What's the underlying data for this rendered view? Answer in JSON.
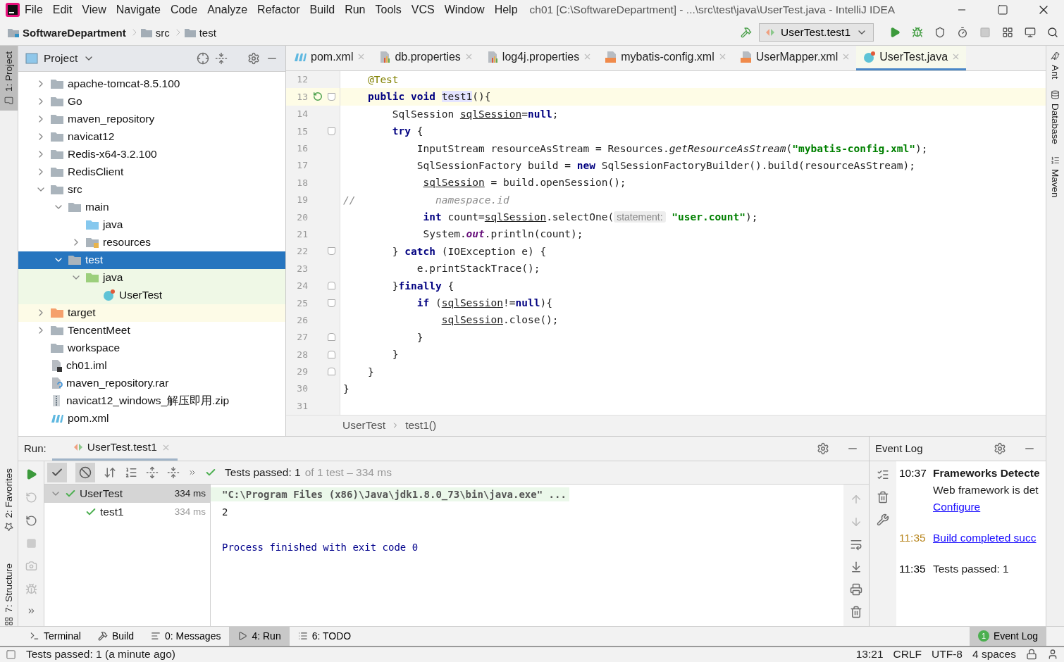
{
  "window": {
    "title": "ch01 [C:\\SoftwareDepartment] - ...\\src\\test\\java\\UserTest.java - IntelliJ IDEA"
  },
  "menu": [
    "File",
    "Edit",
    "View",
    "Navigate",
    "Code",
    "Analyze",
    "Refactor",
    "Build",
    "Run",
    "Tools",
    "VCS",
    "Window",
    "Help"
  ],
  "breadcrumbs": [
    {
      "label": "SoftwareDepartment",
      "kind": "project"
    },
    {
      "label": "src",
      "kind": "folder"
    },
    {
      "label": "test",
      "kind": "folder"
    }
  ],
  "run_config": {
    "label": "UserTest.test1"
  },
  "side_stripes": {
    "left": [
      {
        "label": "1: Project",
        "selected": true,
        "kind": "project"
      },
      {
        "label": "2: Favorites",
        "selected": false,
        "kind": "favorites"
      },
      {
        "label": "7: Structure",
        "selected": false,
        "kind": "structure"
      }
    ],
    "right": [
      {
        "label": "Ant",
        "kind": "ant"
      },
      {
        "label": "Database",
        "kind": "database"
      },
      {
        "label": "Maven",
        "kind": "maven"
      }
    ]
  },
  "project_panel": {
    "title": "Project",
    "tree": [
      {
        "label": "apache-tomcat-8.5.100",
        "kind": "folder",
        "expanded": false,
        "selected": false
      },
      {
        "label": "Go",
        "kind": "folder",
        "expanded": false,
        "selected": false
      },
      {
        "label": "maven_repository",
        "kind": "folder",
        "expanded": false,
        "selected": false
      },
      {
        "label": "navicat12",
        "kind": "folder",
        "expanded": false,
        "selected": false
      },
      {
        "label": "Redis-x64-3.2.100",
        "kind": "folder",
        "expanded": false,
        "selected": false
      },
      {
        "label": "RedisClient",
        "kind": "folder",
        "expanded": false,
        "selected": false
      },
      {
        "label": "src",
        "kind": "folder",
        "expanded": true,
        "selected": false,
        "children": [
          {
            "label": "main",
            "kind": "folder",
            "expanded": true,
            "selected": false,
            "children": [
              {
                "label": "java",
                "kind": "source",
                "selected": false
              },
              {
                "label": "resources",
                "kind": "resources",
                "expanded": false,
                "selected": false
              }
            ]
          },
          {
            "label": "test",
            "kind": "folder",
            "expanded": true,
            "selected": true,
            "children": [
              {
                "label": "java",
                "kind": "test",
                "expanded": true,
                "selected": false,
                "children": [
                  {
                    "label": "UserTest",
                    "kind": "class",
                    "selected": false
                  }
                ]
              }
            ]
          }
        ]
      },
      {
        "label": "target",
        "kind": "excluded",
        "expanded": false,
        "selected": false
      },
      {
        "label": "TencentMeet",
        "kind": "folder",
        "expanded": false,
        "selected": false
      },
      {
        "label": "workspace",
        "kind": "folder",
        "selected": false
      },
      {
        "label": "ch01.iml",
        "kind": "iml",
        "selected": false
      },
      {
        "label": "maven_repository.rar",
        "kind": "unknown",
        "selected": false
      },
      {
        "label": "navicat12_windows_解压即用.zip",
        "kind": "zip",
        "selected": false
      },
      {
        "label": "pom.xml",
        "kind": "maven",
        "selected": false
      }
    ]
  },
  "editor": {
    "tabs": [
      {
        "label": "pom.xml",
        "kind": "maven",
        "selected": false
      },
      {
        "label": "db.properties",
        "kind": "properties",
        "selected": false
      },
      {
        "label": "log4j.properties",
        "kind": "properties",
        "selected": false
      },
      {
        "label": "mybatis-config.xml",
        "kind": "xml",
        "selected": false
      },
      {
        "label": "UserMapper.xml",
        "kind": "xml",
        "selected": false
      },
      {
        "label": "UserTest.java",
        "kind": "class",
        "selected": true
      }
    ],
    "lines": [
      {
        "number": "12",
        "current": false,
        "runnable": false,
        "fold_start": false,
        "fold_end": false,
        "tokens": [
          {
            "kind": "ann",
            "text": "    @Test"
          }
        ]
      },
      {
        "number": "13",
        "current": true,
        "runnable": true,
        "fold_start": true,
        "fold_end": false,
        "tokens": [
          {
            "kind": "kw",
            "text": "    public void "
          },
          {
            "kind": "match",
            "text": "test1"
          },
          {
            "kind": "plain",
            "text": "(){"
          }
        ]
      },
      {
        "number": "14",
        "current": false,
        "runnable": false,
        "fold_start": false,
        "fold_end": false,
        "tokens": [
          {
            "kind": "plain",
            "text": "        SqlSession "
          },
          {
            "kind": "var",
            "text": "sqlSession"
          },
          {
            "kind": "plain",
            "text": "="
          },
          {
            "kind": "kw",
            "text": "null"
          },
          {
            "kind": "plain",
            "text": ";"
          }
        ]
      },
      {
        "number": "15",
        "current": false,
        "runnable": false,
        "fold_start": true,
        "fold_end": false,
        "tokens": [
          {
            "kind": "kw",
            "text": "        try"
          },
          {
            "kind": "plain",
            "text": " {"
          }
        ]
      },
      {
        "number": "16",
        "current": false,
        "runnable": false,
        "fold_start": false,
        "fold_end": false,
        "tokens": [
          {
            "kind": "plain",
            "text": "            InputStream resourceAsStream = Resources."
          },
          {
            "kind": "italic",
            "text": "getResourceAsStream"
          },
          {
            "kind": "plain",
            "text": "("
          },
          {
            "kind": "str",
            "text": "\"mybatis-config.xml\""
          },
          {
            "kind": "plain",
            "text": ");"
          }
        ]
      },
      {
        "number": "17",
        "current": false,
        "runnable": false,
        "fold_start": false,
        "fold_end": false,
        "tokens": [
          {
            "kind": "plain",
            "text": "            SqlSessionFactory build = "
          },
          {
            "kind": "kw",
            "text": "new"
          },
          {
            "kind": "plain",
            "text": " SqlSessionFactoryBuilder().build(resourceAsStream);"
          }
        ]
      },
      {
        "number": "18",
        "current": false,
        "runnable": false,
        "fold_start": false,
        "fold_end": false,
        "tokens": [
          {
            "kind": "var",
            "text": "             sqlSession"
          },
          {
            "kind": "plain",
            "text": " = build.openSession();"
          }
        ]
      },
      {
        "number": "19",
        "current": false,
        "runnable": false,
        "fold_start": false,
        "fold_end": false,
        "tokens": [
          {
            "kind": "comment",
            "text": "//             namespace.id"
          }
        ]
      },
      {
        "number": "20",
        "current": false,
        "runnable": false,
        "fold_start": false,
        "fold_end": false,
        "tokens": [
          {
            "kind": "kw",
            "text": "             int"
          },
          {
            "kind": "plain",
            "text": " count="
          },
          {
            "kind": "var",
            "text": "sqlSession"
          },
          {
            "kind": "plain",
            "text": ".selectOne("
          },
          {
            "kind": "hint",
            "text": "statement:"
          },
          {
            "kind": "str",
            "text": " \"user.count\""
          },
          {
            "kind": "plain",
            "text": ");"
          }
        ]
      },
      {
        "number": "21",
        "current": false,
        "runnable": false,
        "fold_start": false,
        "fold_end": false,
        "tokens": [
          {
            "kind": "plain",
            "text": "             System."
          },
          {
            "kind": "field",
            "text": "out"
          },
          {
            "kind": "plain",
            "text": ".println(count);"
          }
        ]
      },
      {
        "number": "22",
        "current": false,
        "runnable": false,
        "fold_start": true,
        "fold_end": false,
        "tokens": [
          {
            "kind": "plain",
            "text": "        } "
          },
          {
            "kind": "kw",
            "text": "catch"
          },
          {
            "kind": "plain",
            "text": " (IOException e) {"
          }
        ]
      },
      {
        "number": "23",
        "current": false,
        "runnable": false,
        "fold_start": false,
        "fold_end": false,
        "tokens": [
          {
            "kind": "plain",
            "text": "            e.printStackTrace();"
          }
        ]
      },
      {
        "number": "24",
        "current": false,
        "runnable": false,
        "fold_start": false,
        "fold_end": true,
        "tokens": [
          {
            "kind": "plain",
            "text": "        }"
          },
          {
            "kind": "kw",
            "text": "finally"
          },
          {
            "kind": "plain",
            "text": " {"
          }
        ]
      },
      {
        "number": "25",
        "current": false,
        "runnable": false,
        "fold_start": true,
        "fold_end": false,
        "tokens": [
          {
            "kind": "kw",
            "text": "            if"
          },
          {
            "kind": "plain",
            "text": " ("
          },
          {
            "kind": "var",
            "text": "sqlSession"
          },
          {
            "kind": "plain",
            "text": "!="
          },
          {
            "kind": "kw",
            "text": "null"
          },
          {
            "kind": "plain",
            "text": "){"
          }
        ]
      },
      {
        "number": "26",
        "current": false,
        "runnable": false,
        "fold_start": false,
        "fold_end": false,
        "tokens": [
          {
            "kind": "var",
            "text": "                sqlSession"
          },
          {
            "kind": "plain",
            "text": ".close();"
          }
        ]
      },
      {
        "number": "27",
        "current": false,
        "runnable": false,
        "fold_start": false,
        "fold_end": true,
        "tokens": [
          {
            "kind": "plain",
            "text": "            }"
          }
        ]
      },
      {
        "number": "28",
        "current": false,
        "runnable": false,
        "fold_start": false,
        "fold_end": true,
        "tokens": [
          {
            "kind": "plain",
            "text": "        }"
          }
        ]
      },
      {
        "number": "29",
        "current": false,
        "runnable": false,
        "fold_start": false,
        "fold_end": true,
        "tokens": [
          {
            "kind": "plain",
            "text": "    }"
          }
        ]
      },
      {
        "number": "30",
        "current": false,
        "runnable": false,
        "fold_start": false,
        "fold_end": false,
        "tokens": [
          {
            "kind": "plain",
            "text": "}"
          }
        ]
      },
      {
        "number": "31",
        "current": false,
        "runnable": false,
        "fold_start": false,
        "fold_end": false
      }
    ],
    "breadcrumb": [
      "UserTest",
      "test1()"
    ]
  },
  "run_panel": {
    "label": "Run:",
    "tab": {
      "label": "UserTest.test1"
    },
    "filters": [
      {
        "kind": "passed",
        "on": true
      },
      {
        "kind": "ignored",
        "on": true
      }
    ],
    "summary": "Tests passed: 1",
    "summary_detail": "of 1 test – 334 ms",
    "tests": [
      {
        "name": "UserTest",
        "time": "334 ms",
        "selected": true,
        "expanded": true,
        "children": [
          {
            "name": "test1",
            "time": "334 ms",
            "selected": false
          }
        ]
      }
    ],
    "console": [
      {
        "kind": "command",
        "text": "\"C:\\Program Files (x86)\\Java\\jdk1.8.0_73\\bin\\java.exe\" ..."
      },
      {
        "kind": "output",
        "text": "2"
      },
      {
        "kind": "exit",
        "text": "Process finished with exit code 0"
      }
    ]
  },
  "event_log": {
    "title": "Event Log",
    "entries": [
      {
        "time": "10:37",
        "color": "#000000",
        "title": "Frameworks Detecte",
        "text": "Web framework is det",
        "link": "Configure"
      },
      {
        "time": "11:35",
        "color": "#b8861f",
        "link": "Build completed succ"
      },
      {
        "time": "11:35",
        "color": "#000000",
        "text": "Tests passed: 1"
      }
    ]
  },
  "tool_windows": [
    {
      "label": "Terminal",
      "kind": "terminal",
      "selected": false
    },
    {
      "label": "Build",
      "kind": "build",
      "selected": false
    },
    {
      "label": "0: Messages",
      "kind": "messages",
      "selected": false
    },
    {
      "label": "4: Run",
      "kind": "run",
      "selected": true
    },
    {
      "label": "6: TODO",
      "kind": "todo",
      "selected": false
    }
  ],
  "event_log_button": {
    "label": "Event Log",
    "badge": "1"
  },
  "status_bar": {
    "message": "Tests passed: 1 (a minute ago)",
    "items": [
      "13:21",
      "CRLF",
      "UTF-8",
      "4 spaces"
    ]
  }
}
